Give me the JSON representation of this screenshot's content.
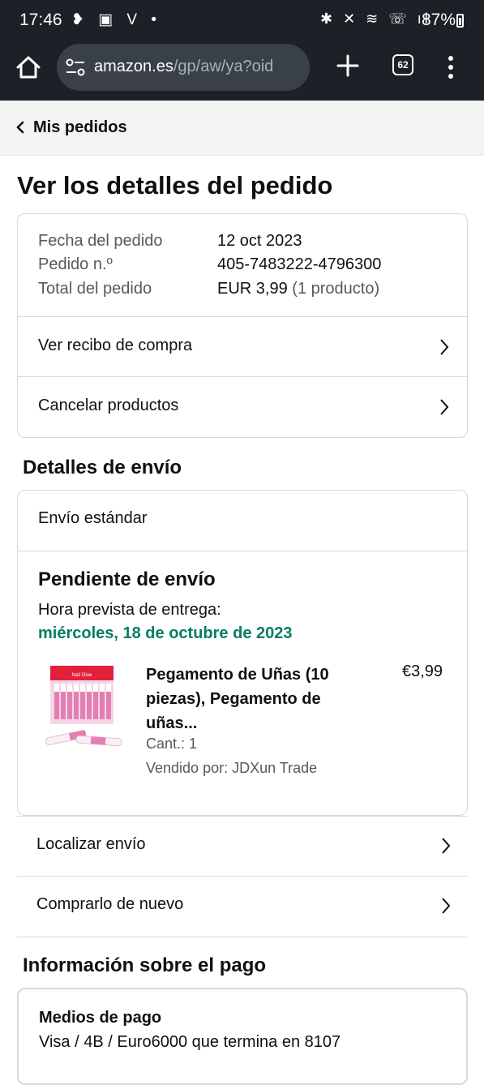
{
  "status_bar": {
    "time": "17:46",
    "left_icons": "❥ ▣ V •",
    "battery": "87%"
  },
  "browser": {
    "url_host": "amazon.es",
    "url_path": "/gp/aw/ya?oid",
    "tab_count": "62"
  },
  "nav": {
    "back_label": "Mis pedidos"
  },
  "page_title": "Ver los detalles del pedido",
  "order_summary": {
    "date_label": "Fecha del pedido",
    "date_value": "12 oct 2023",
    "number_label": "Pedido n.º",
    "number_value": "405-7483222-4796300",
    "total_label": "Total del pedido",
    "total_value": "EUR 3,99",
    "total_count": "(1 producto)"
  },
  "order_actions": {
    "receipt": "Ver recibo de compra",
    "cancel": "Cancelar productos"
  },
  "shipping": {
    "section_title": "Detalles de envío",
    "method": "Envío estándar",
    "status": "Pendiente de envío",
    "eta_label": "Hora prevista de entrega:",
    "eta_value": "miércoles, 18 de octubre de 2023",
    "product": {
      "title": "Pegamento de Uñas (10 piezas), Pegamento de uñas...",
      "price": "€3,99",
      "quantity": "Cant.: 1",
      "seller": "Vendido por: JDXun Trade",
      "box_text": "Nail Glue"
    },
    "track": "Localizar envío",
    "buy_again": "Comprarlo de nuevo"
  },
  "payment": {
    "section_title": "Información sobre el pago",
    "method_label": "Medios de pago",
    "method_value": "Visa / 4B / Euro6000 que termina en 8107"
  },
  "colors": {
    "system_bar": "#1b2127",
    "eta_green": "#067d62",
    "nav_bg": "#f2f3f3"
  }
}
